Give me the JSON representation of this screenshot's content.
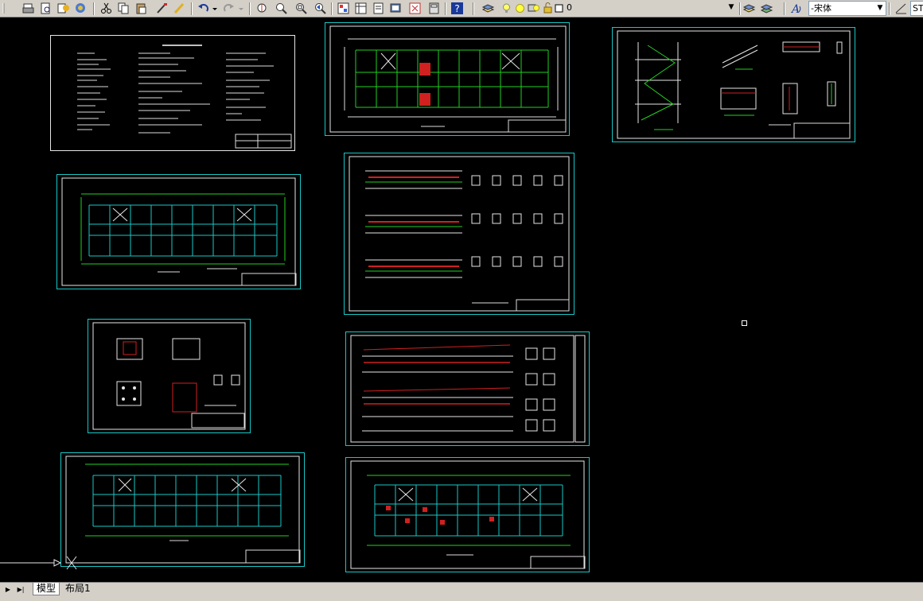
{
  "toolbar": {
    "layer_value": "0",
    "font_value": "-宋体",
    "style_value": "ST"
  },
  "tabs": {
    "model_label": "模型",
    "layout1_label": "布局1"
  },
  "colors": {
    "canvas": "#000000",
    "frame": "#19c7c7",
    "linework": "#e6e6e6",
    "accent": "#ff2020",
    "grid": "#22d022"
  },
  "sheets": [
    {
      "name": "design-notes-sheet"
    },
    {
      "name": "floor-plan-sheet-1"
    },
    {
      "name": "stair-detail-sheet"
    },
    {
      "name": "framing-plan-sheet"
    },
    {
      "name": "beam-reinforcement-sheet"
    },
    {
      "name": "foundation-detail-sheet"
    },
    {
      "name": "column-reinforcement-sheet"
    },
    {
      "name": "structural-layout-sheet"
    },
    {
      "name": "slab-plan-sheet"
    }
  ]
}
